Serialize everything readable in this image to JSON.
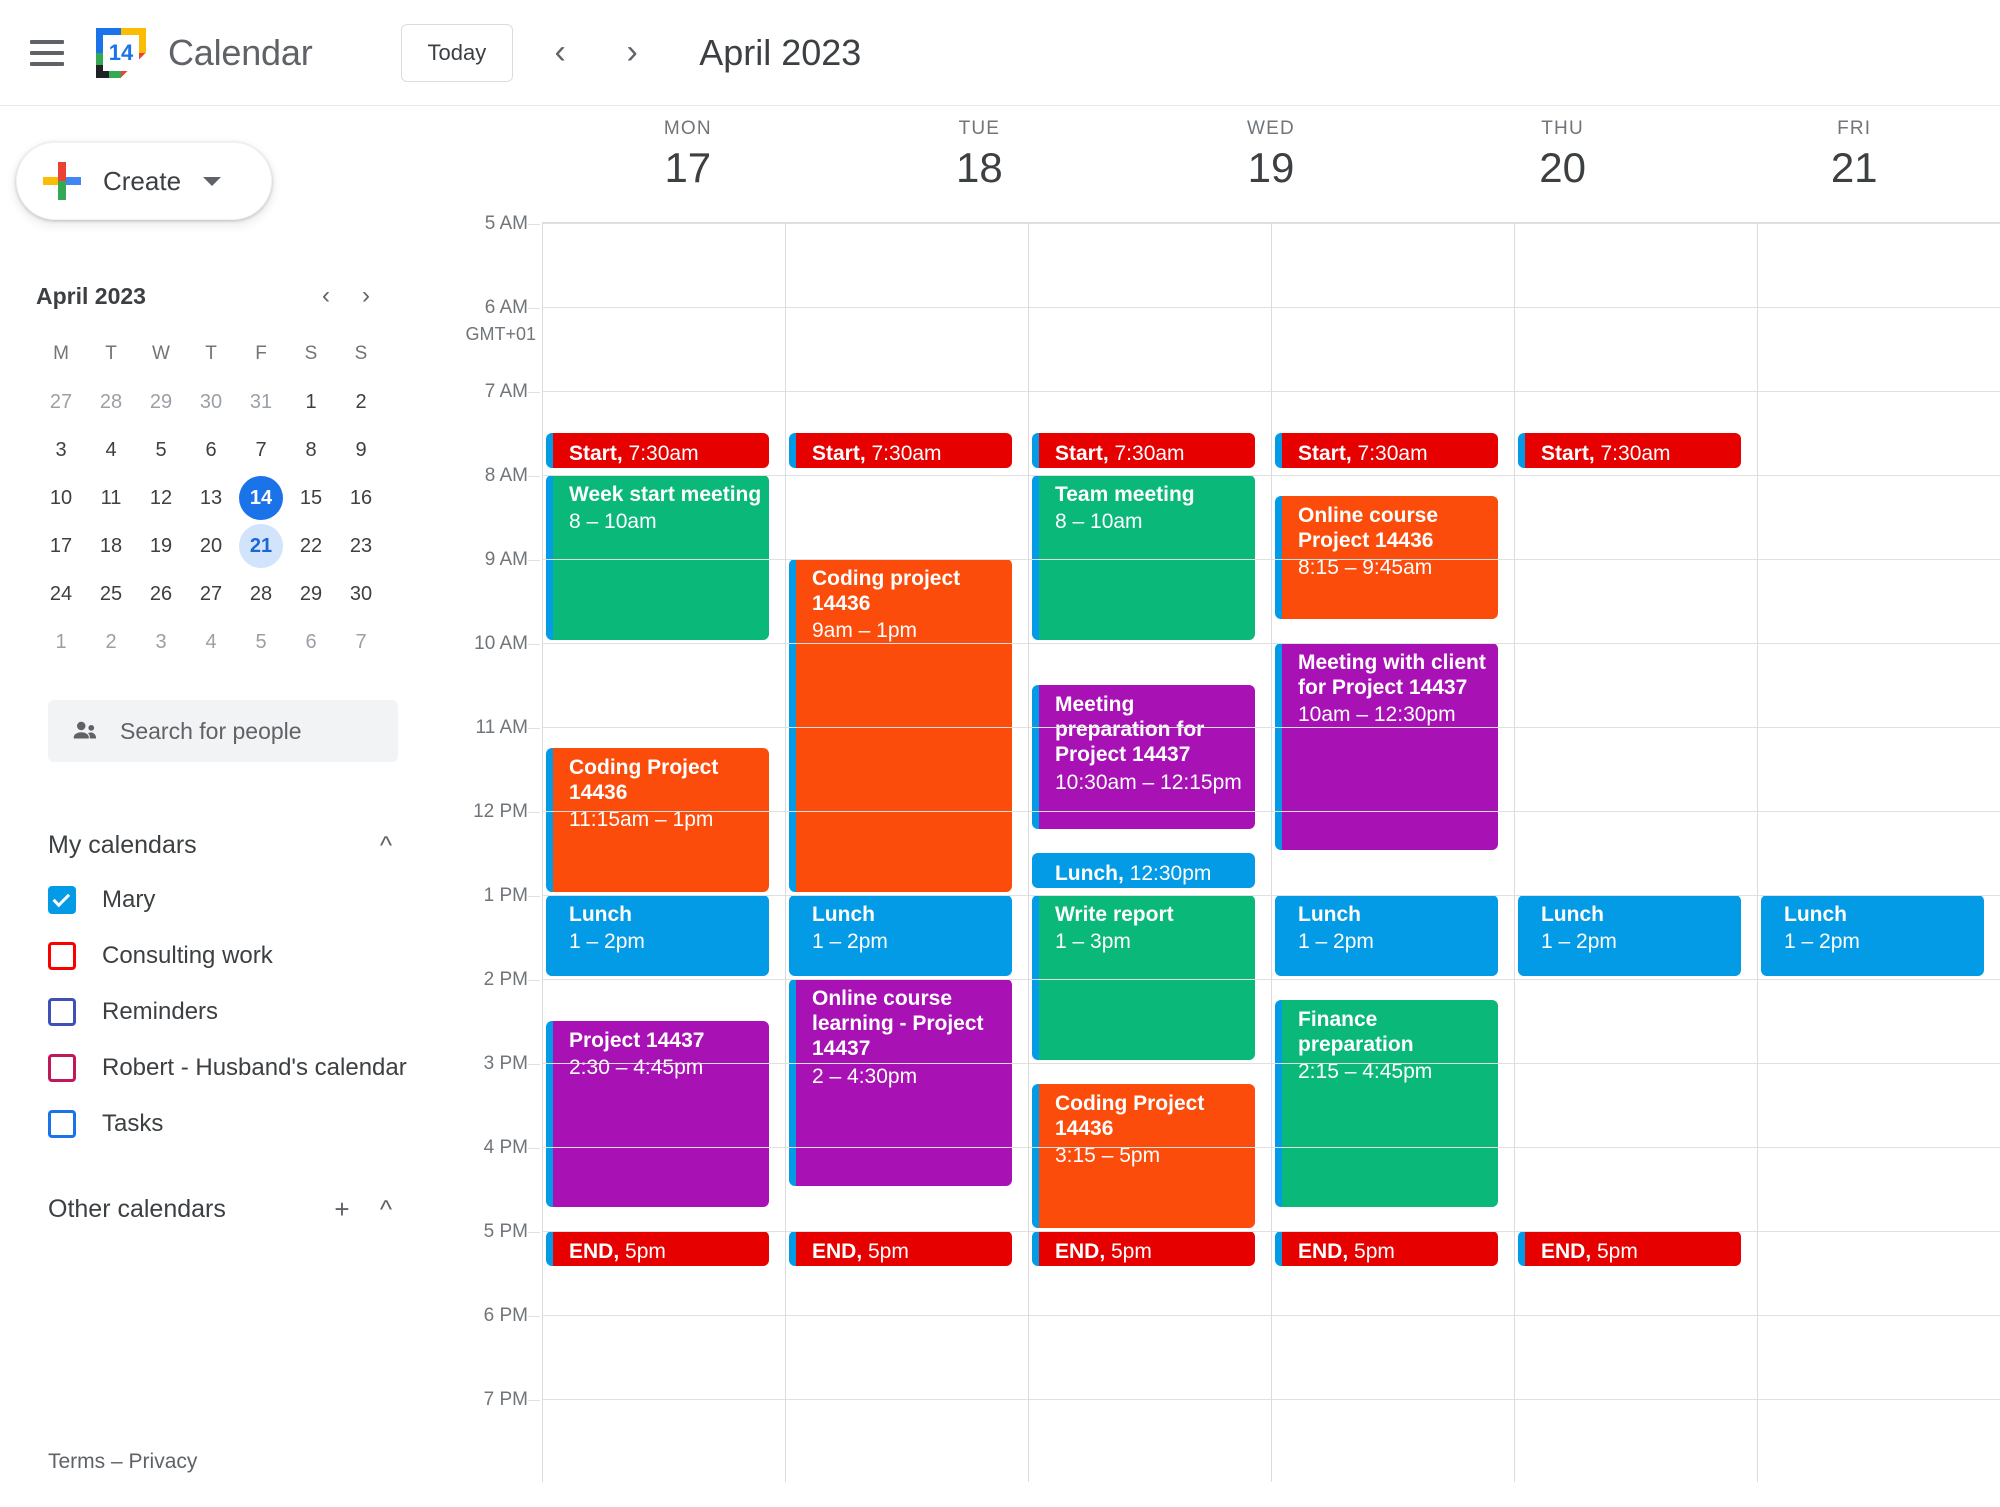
{
  "topbar": {
    "menu_icon": "hamburger-menu-icon",
    "logo_day": "14",
    "app_title": "Calendar",
    "today_label": "Today",
    "prev_icon": "chevron-left-icon",
    "next_icon": "chevron-right-icon",
    "period_title": "April 2023"
  },
  "sidebar": {
    "create_label": "Create",
    "create_dropdown_icon": "chevron-down-icon",
    "mini_calendar": {
      "title": "April 2023",
      "prev_icon": "chevron-left-icon",
      "next_icon": "chevron-right-icon",
      "dow": [
        "M",
        "T",
        "W",
        "T",
        "F",
        "S",
        "S"
      ],
      "weeks": [
        [
          {
            "d": "27",
            "s": "muted"
          },
          {
            "d": "28",
            "s": "muted"
          },
          {
            "d": "29",
            "s": "muted"
          },
          {
            "d": "30",
            "s": "muted"
          },
          {
            "d": "31",
            "s": "muted"
          },
          {
            "d": "1",
            "s": ""
          },
          {
            "d": "2",
            "s": ""
          }
        ],
        [
          {
            "d": "3",
            "s": ""
          },
          {
            "d": "4",
            "s": ""
          },
          {
            "d": "5",
            "s": ""
          },
          {
            "d": "6",
            "s": ""
          },
          {
            "d": "7",
            "s": ""
          },
          {
            "d": "8",
            "s": ""
          },
          {
            "d": "9",
            "s": ""
          }
        ],
        [
          {
            "d": "10",
            "s": ""
          },
          {
            "d": "11",
            "s": ""
          },
          {
            "d": "12",
            "s": ""
          },
          {
            "d": "13",
            "s": ""
          },
          {
            "d": "14",
            "s": "today"
          },
          {
            "d": "15",
            "s": ""
          },
          {
            "d": "16",
            "s": ""
          }
        ],
        [
          {
            "d": "17",
            "s": ""
          },
          {
            "d": "18",
            "s": ""
          },
          {
            "d": "19",
            "s": ""
          },
          {
            "d": "20",
            "s": ""
          },
          {
            "d": "21",
            "s": "sel"
          },
          {
            "d": "22",
            "s": ""
          },
          {
            "d": "23",
            "s": ""
          }
        ],
        [
          {
            "d": "24",
            "s": ""
          },
          {
            "d": "25",
            "s": ""
          },
          {
            "d": "26",
            "s": ""
          },
          {
            "d": "27",
            "s": ""
          },
          {
            "d": "28",
            "s": ""
          },
          {
            "d": "29",
            "s": ""
          },
          {
            "d": "30",
            "s": ""
          }
        ],
        [
          {
            "d": "1",
            "s": "muted"
          },
          {
            "d": "2",
            "s": "muted"
          },
          {
            "d": "3",
            "s": "muted"
          },
          {
            "d": "4",
            "s": "muted"
          },
          {
            "d": "5",
            "s": "muted"
          },
          {
            "d": "6",
            "s": "muted"
          },
          {
            "d": "7",
            "s": "muted"
          }
        ]
      ]
    },
    "search_people": {
      "icon": "people-icon",
      "placeholder": "Search for people"
    },
    "my_calendars": {
      "title": "My calendars",
      "collapse_icon": "chevron-up-icon",
      "items": [
        {
          "label": "Mary",
          "color": "#039be5",
          "checked": true
        },
        {
          "label": "Consulting work",
          "color": "#fa0000",
          "checked": false
        },
        {
          "label": "Reminders",
          "color": "#3f51b5",
          "checked": false
        },
        {
          "label": "Robert - Husband's calendar",
          "color": "#c0185b",
          "checked": false
        },
        {
          "label": "Tasks",
          "color": "#1a73e8",
          "checked": false
        }
      ]
    },
    "other_calendars": {
      "title": "Other calendars",
      "add_icon": "plus-icon",
      "collapse_icon": "chevron-up-icon",
      "items": []
    },
    "footer": {
      "terms": "Terms",
      "separator": "–",
      "privacy": "Privacy"
    }
  },
  "grid": {
    "timezone_label": "GMT+01",
    "days": [
      {
        "dow": "MON",
        "num": "17"
      },
      {
        "dow": "TUE",
        "num": "18"
      },
      {
        "dow": "WED",
        "num": "19"
      },
      {
        "dow": "THU",
        "num": "20"
      },
      {
        "dow": "FRI",
        "num": "21"
      }
    ],
    "hours": [
      "5 AM",
      "6 AM",
      "7 AM",
      "8 AM",
      "9 AM",
      "10 AM",
      "11 AM",
      "12 PM",
      "1 PM",
      "2 PM",
      "3 PM",
      "4 PM",
      "5 PM",
      "6 PM",
      "7 PM"
    ],
    "hour_start": 5,
    "hour_end": 20,
    "colors": {
      "red": "#e60000",
      "green": "#0ab87a",
      "orange": "#fb4c0b",
      "purple": "#a812b5",
      "blue": "#039be5",
      "stripe": "#039be5"
    },
    "events": [
      {
        "day": 0,
        "start": 7.5,
        "end": 7.95,
        "title": "Start,",
        "time": "7:30am",
        "color": "red",
        "inline": true
      },
      {
        "day": 0,
        "start": 8.0,
        "end": 10.0,
        "title": "Week start meeting",
        "time": "8 – 10am",
        "color": "green",
        "inline": false
      },
      {
        "day": 0,
        "start": 11.25,
        "end": 13.0,
        "title": "Coding Project 14436",
        "time": "11:15am – 1pm",
        "color": "orange",
        "inline": false
      },
      {
        "day": 0,
        "start": 13.0,
        "end": 14.0,
        "title": "Lunch",
        "time": "1 – 2pm",
        "color": "blue",
        "inline": false
      },
      {
        "day": 0,
        "start": 14.5,
        "end": 16.75,
        "title": "Project 14437",
        "time": "2:30 – 4:45pm",
        "color": "purple",
        "inline": false
      },
      {
        "day": 0,
        "start": 17.0,
        "end": 17.45,
        "title": "END,",
        "time": "5pm",
        "color": "red",
        "inline": true
      },
      {
        "day": 1,
        "start": 7.5,
        "end": 7.95,
        "title": "Start,",
        "time": "7:30am",
        "color": "red",
        "inline": true
      },
      {
        "day": 1,
        "start": 9.0,
        "end": 13.0,
        "title": "Coding project 14436",
        "time": "9am – 1pm",
        "color": "orange",
        "inline": false
      },
      {
        "day": 1,
        "start": 13.0,
        "end": 14.0,
        "title": "Lunch",
        "time": "1 – 2pm",
        "color": "blue",
        "inline": false
      },
      {
        "day": 1,
        "start": 14.0,
        "end": 16.5,
        "title": "Online course learning - Project 14437",
        "time": "2 – 4:30pm",
        "color": "purple",
        "inline": false
      },
      {
        "day": 1,
        "start": 17.0,
        "end": 17.45,
        "title": "END,",
        "time": "5pm",
        "color": "red",
        "inline": true
      },
      {
        "day": 2,
        "start": 7.5,
        "end": 7.95,
        "title": "Start,",
        "time": "7:30am",
        "color": "red",
        "inline": true
      },
      {
        "day": 2,
        "start": 8.0,
        "end": 10.0,
        "title": "Team meeting",
        "time": "8 – 10am",
        "color": "green",
        "inline": false
      },
      {
        "day": 2,
        "start": 10.5,
        "end": 12.25,
        "title": "Meeting preparation for Project 14437",
        "time": "10:30am – 12:15pm",
        "color": "purple",
        "inline": false
      },
      {
        "day": 2,
        "start": 12.5,
        "end": 12.95,
        "title": "Lunch,",
        "time": "12:30pm",
        "color": "blue",
        "inline": true
      },
      {
        "day": 2,
        "start": 13.0,
        "end": 15.0,
        "title": "Write report",
        "time": "1 – 3pm",
        "color": "green",
        "inline": false
      },
      {
        "day": 2,
        "start": 15.25,
        "end": 17.0,
        "title": "Coding Project 14436",
        "time": "3:15 – 5pm",
        "color": "orange",
        "inline": false
      },
      {
        "day": 2,
        "start": 17.0,
        "end": 17.45,
        "title": "END,",
        "time": "5pm",
        "color": "red",
        "inline": true
      },
      {
        "day": 3,
        "start": 7.5,
        "end": 7.95,
        "title": "Start,",
        "time": "7:30am",
        "color": "red",
        "inline": true
      },
      {
        "day": 3,
        "start": 8.25,
        "end": 9.75,
        "title": "Online course Project 14436",
        "time": "8:15 – 9:45am",
        "color": "orange",
        "inline": false
      },
      {
        "day": 3,
        "start": 10.0,
        "end": 12.5,
        "title": "Meeting with client for Project 14437",
        "time": "10am – 12:30pm",
        "color": "purple",
        "inline": false
      },
      {
        "day": 3,
        "start": 13.0,
        "end": 14.0,
        "title": "Lunch",
        "time": "1 – 2pm",
        "color": "blue",
        "inline": false
      },
      {
        "day": 3,
        "start": 14.25,
        "end": 16.75,
        "title": "Finance preparation",
        "time": "2:15 – 4:45pm",
        "color": "green",
        "inline": false
      },
      {
        "day": 3,
        "start": 17.0,
        "end": 17.45,
        "title": "END,",
        "time": "5pm",
        "color": "red",
        "inline": true
      },
      {
        "day": 4,
        "start": 7.5,
        "end": 7.95,
        "title": "Start,",
        "time": "7:30am",
        "color": "red",
        "inline": true
      },
      {
        "day": 4,
        "start": 13.0,
        "end": 14.0,
        "title": "Lunch",
        "time": "1 – 2pm",
        "color": "blue",
        "inline": false
      },
      {
        "day": 4,
        "start": 17.0,
        "end": 17.45,
        "title": "END,",
        "time": "5pm",
        "color": "red",
        "inline": true
      },
      {
        "day": 5,
        "start": 13.0,
        "end": 14.0,
        "title": "Lunch",
        "time": "1 – 2pm",
        "color": "blue",
        "inline": false
      }
    ]
  }
}
